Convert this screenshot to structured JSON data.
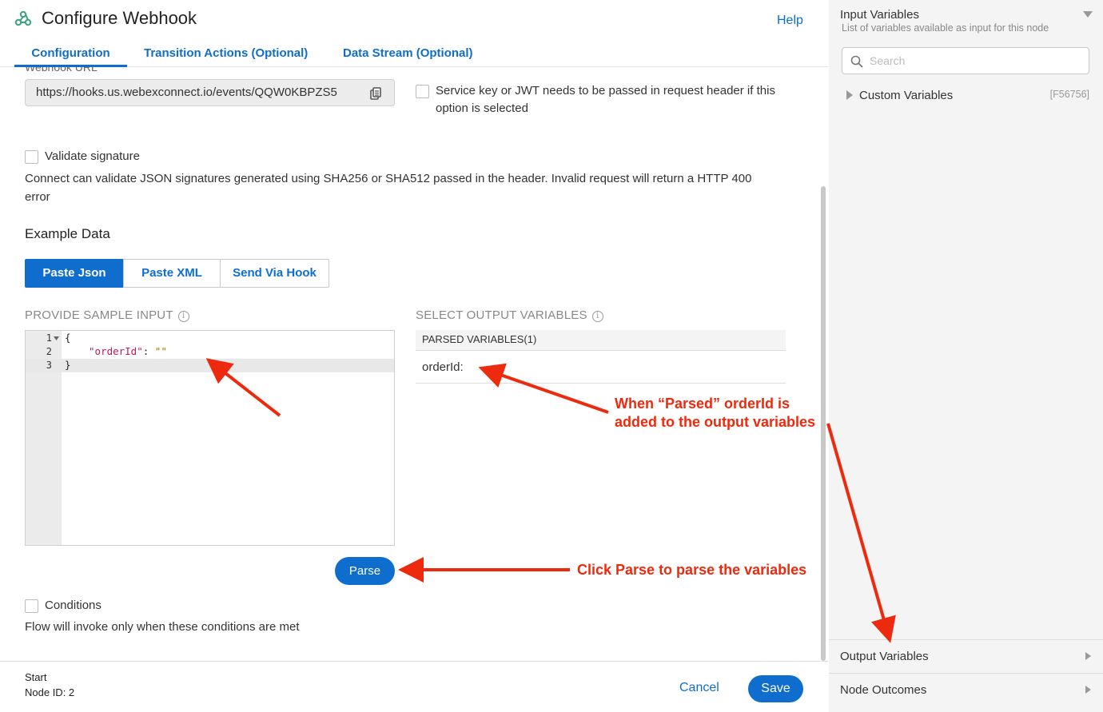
{
  "header": {
    "title": "Configure Webhook",
    "help_label": "Help",
    "tabs": [
      {
        "label": "Configuration"
      },
      {
        "label": "Transition Actions (Optional)"
      },
      {
        "label": "Data Stream (Optional)"
      }
    ]
  },
  "webhook": {
    "cut_label": "Webhook URL",
    "url": "https://hooks.us.webexconnect.io/events/QQW0KBPZS5",
    "service_key_text": "Service key or JWT needs to be passed in request header if this option is selected"
  },
  "validate": {
    "label": "Validate signature",
    "description": "Connect can validate JSON signatures generated using SHA256 or SHA512 passed in the header. Invalid request will return a HTTP 400 error"
  },
  "example": {
    "title": "Example Data",
    "buttons": [
      "Paste Json",
      "Paste XML",
      "Send Via Hook"
    ],
    "input_label": "PROVIDE SAMPLE INPUT",
    "output_label": "SELECT OUTPUT VARIABLES",
    "info_icon": "i",
    "code_lines": [
      {
        "num": "1",
        "text": "{"
      },
      {
        "num": "2",
        "key": "\"orderId\"",
        "sep": ": ",
        "val": "\"\""
      },
      {
        "num": "3",
        "text": "}"
      }
    ],
    "parsed_header": "PARSED VARIABLES(1)",
    "parsed_items": [
      "orderId:"
    ],
    "parse_label": "Parse"
  },
  "conditions": {
    "label": "Conditions",
    "description": "Flow will invoke only when these conditions are met"
  },
  "footer": {
    "start_label": "Start",
    "node_id": "Node ID: 2",
    "cancel_label": "Cancel",
    "save_label": "Save"
  },
  "side": {
    "title": "Input Variables",
    "subtitle": "List of variables available as input for this node",
    "search_placeholder": "Search",
    "custom_label": "Custom Variables",
    "custom_code": "[F56756]",
    "output_label": "Output Variables",
    "outcomes_label": "Node Outcomes"
  },
  "annotations": {
    "parsed_line1": "When “Parsed” orderId is",
    "parsed_line2": "added to the output variables",
    "click": "Click Parse to parse the variables"
  },
  "colors": {
    "accent": "#0f6ecd",
    "annotation": "#ee2a0e",
    "logo": "#3aa57a"
  }
}
